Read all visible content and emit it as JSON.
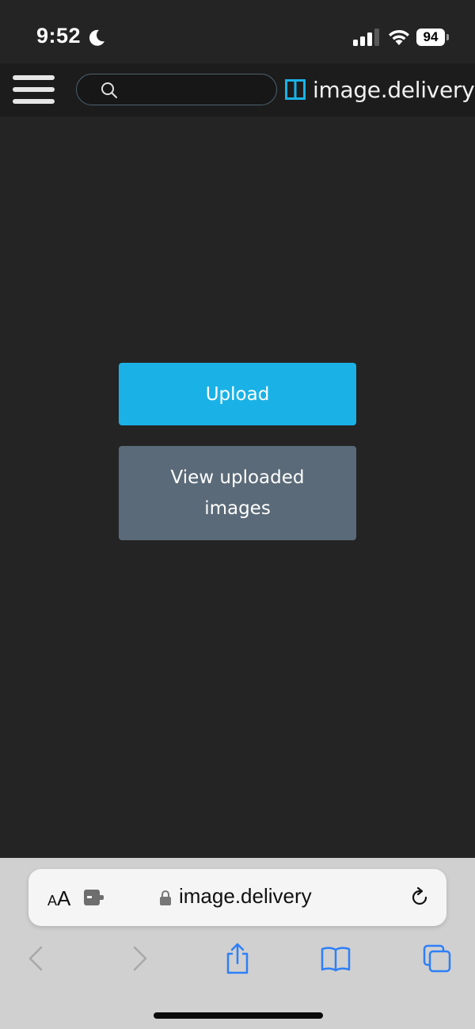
{
  "status_bar": {
    "time": "9:52",
    "battery_level": "94",
    "icons": [
      "moon-icon",
      "cellular-signal-icon",
      "wifi-icon",
      "battery-icon"
    ]
  },
  "header": {
    "menu_icon": "hamburger-menu-icon",
    "search": {
      "placeholder": "",
      "value": ""
    },
    "brand": {
      "name": "image.delivery",
      "icon": "sidebar-panel-icon",
      "accent": "#1ab2e6"
    }
  },
  "main": {
    "upload_label": "Upload",
    "view_uploaded_label": "View uploaded images"
  },
  "colors": {
    "background": "#242424",
    "upload_button": "#1ab2e6",
    "view_button": "#5a6a78",
    "browser_bar": "#d0d0d0",
    "toolbar_icon": "#2d7ff9"
  },
  "browser": {
    "text_size_label_large": "A",
    "text_size_label_small": "A",
    "url": "image.delivery",
    "toolbar": [
      "back-icon",
      "forward-icon",
      "share-icon",
      "bookmarks-icon",
      "tabs-icon"
    ]
  }
}
